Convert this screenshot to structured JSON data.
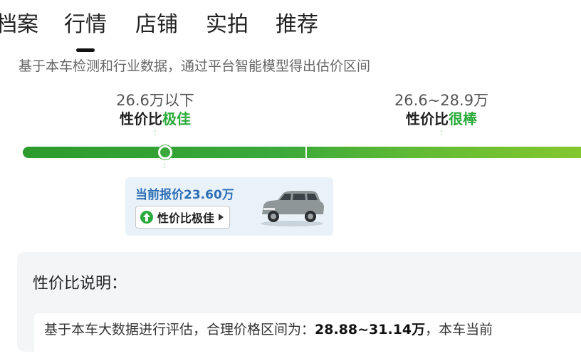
{
  "tabs": [
    {
      "label": "档案",
      "active": false
    },
    {
      "label": "行情",
      "active": true
    },
    {
      "label": "店铺",
      "active": false
    },
    {
      "label": "实拍",
      "active": false
    },
    {
      "label": "推荐",
      "active": false
    }
  ],
  "subtitle": "基于本车检测和行业数据，通过平台智能模型得出估价区间",
  "levels": [
    {
      "range": "26.6万以下",
      "rating_prefix": "性价比",
      "rating_highlight": "极佳"
    },
    {
      "range": "26.6~28.9万",
      "rating_prefix": "性价比",
      "rating_highlight": "很棒"
    }
  ],
  "current_price": {
    "text": "当前报价23.60万",
    "badge_label": "性价比极佳",
    "badge_icon": "arrow-up-circle-icon",
    "image": "car-thumbnail"
  },
  "colors": {
    "accent_green": "#2aaa3a",
    "price_blue": "#2d6fb6"
  },
  "explain": {
    "title": "性价比说明：",
    "text_prefix": "基于本车大数据进行评估，合理价格区间为：",
    "text_range": "28.88~31.14万",
    "text_suffix": "，本车当前"
  }
}
